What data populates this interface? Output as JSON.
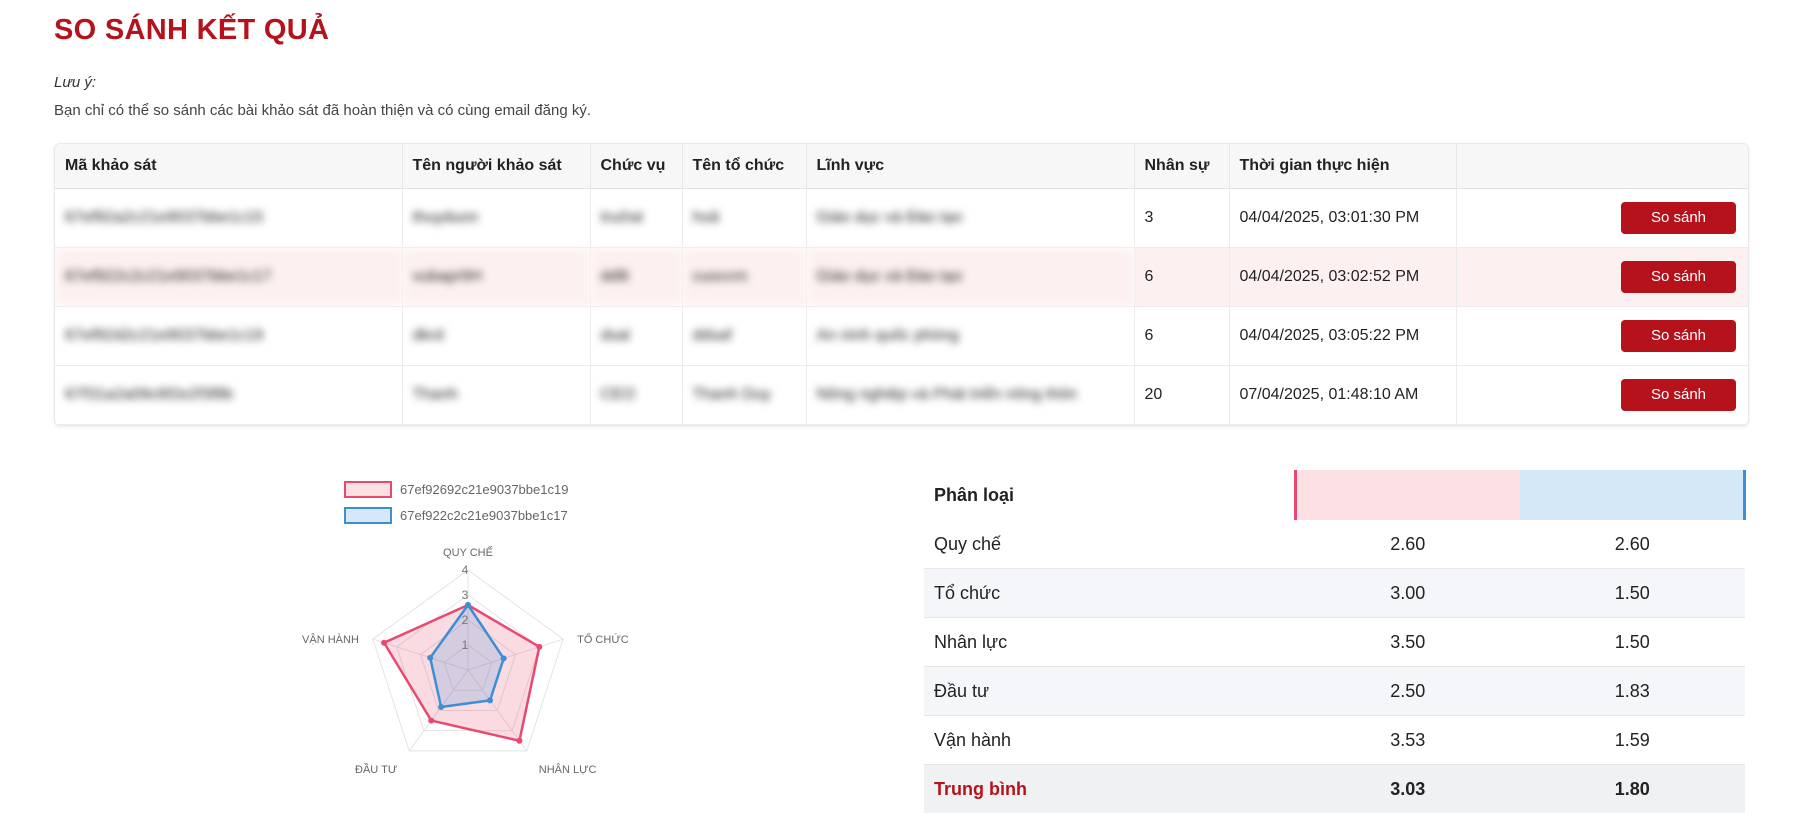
{
  "page_title": "SO SÁNH KẾT QUẢ",
  "note": {
    "label": "Lưu ý:",
    "text": "Bạn chỉ có thể so sánh các bài khảo sát đã hoàn thiện và có cùng email đăng ký."
  },
  "table": {
    "headers": [
      "Mã khảo sát",
      "Tên người khảo sát",
      "Chức vụ",
      "Tên tổ chức",
      "Lĩnh vực",
      "Nhân sự",
      "Thời gian thực hiện",
      ""
    ],
    "rows": [
      {
        "code": "67ef92a2c21e9037bbe1c15",
        "name": "thuyduon",
        "position": "truởat",
        "org": "hoả",
        "field": "Giáo dục và Đào tạo",
        "staff": "3",
        "time": "04/04/2025, 03:01:30 PM",
        "action": "So sánh"
      },
      {
        "code": "67ef922c2c21e9037bbe1c17",
        "name": "vubapr9H",
        "position": "ddlli",
        "org": "cuoccm",
        "field": "Giáo dục và Đào tạo",
        "staff": "6",
        "time": "04/04/2025, 03:02:52 PM",
        "action": "So sánh"
      },
      {
        "code": "67ef92d2c21e9037bbe1c19",
        "name": "dkrd",
        "position": "dsal",
        "org": "ddsaf",
        "field": "An ninh quốc phòng",
        "staff": "6",
        "time": "04/04/2025, 03:05:22 PM",
        "action": "So sánh"
      },
      {
        "code": "67f31a2a09c6f2e2f3f8b",
        "name": "Thanh",
        "position": "CEO",
        "org": "Thanh Duy",
        "field": "Nông nghiệp và Phát triển nông thôn",
        "staff": "20",
        "time": "07/04/2025, 01:48:10 AM",
        "action": "So sánh"
      }
    ]
  },
  "legend": [
    "67ef92692c21e9037bbe1c19",
    "67ef922c2c21e9037bbe1c17"
  ],
  "colors": {
    "accent": "#b5121b",
    "series_a": "#e8496f",
    "series_b": "#3c8fd6"
  },
  "chart_data": {
    "type": "radar",
    "axes": [
      "QUY CHẾ",
      "TỔ CHỨC",
      "NHÂN LỰC",
      "ĐẦU TƯ",
      "VẬN HÀNH"
    ],
    "ticks": [
      "1",
      "2",
      "3",
      "4"
    ],
    "range": [
      0,
      4
    ],
    "series": [
      {
        "name": "67ef92692c21e9037bbe1c19",
        "values": [
          2.6,
          3.0,
          3.5,
          2.5,
          3.53
        ]
      },
      {
        "name": "67ef922c2c21e9037bbe1c17",
        "values": [
          2.6,
          1.5,
          1.5,
          1.83,
          1.59
        ]
      }
    ]
  },
  "scores": {
    "header_label": "Phân loại",
    "rows": [
      {
        "label": "Quy chế",
        "a": "2.60",
        "b": "2.60"
      },
      {
        "label": "Tổ chức",
        "a": "3.00",
        "b": "1.50"
      },
      {
        "label": "Nhân lực",
        "a": "3.50",
        "b": "1.50"
      },
      {
        "label": "Đầu tư",
        "a": "2.50",
        "b": "1.83"
      },
      {
        "label": "Vận hành",
        "a": "3.53",
        "b": "1.59"
      }
    ],
    "average": {
      "label": "Trung bình",
      "a": "3.03",
      "b": "1.80"
    }
  }
}
